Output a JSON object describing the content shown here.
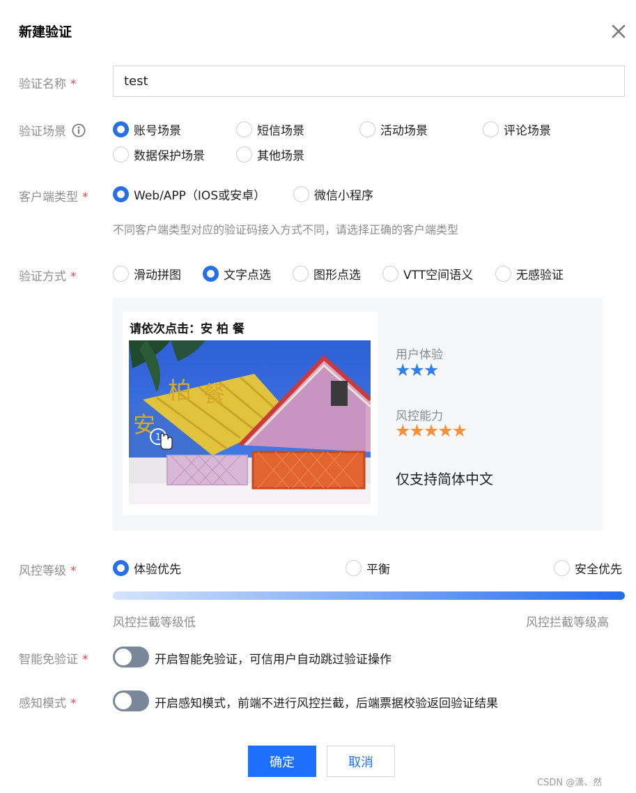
{
  "dialog": {
    "title": "新建验证"
  },
  "form": {
    "name": {
      "label": "验证名称",
      "value": "test"
    },
    "scene": {
      "label": "验证场景",
      "options": [
        "账号场景",
        "短信场景",
        "活动场景",
        "评论场景",
        "数据保护场景",
        "其他场景"
      ],
      "selected": "账号场景"
    },
    "client_type": {
      "label": "客户端类型",
      "options": [
        "Web/APP（IOS或安卓）",
        "微信小程序"
      ],
      "selected": "Web/APP（IOS或安卓）",
      "hint": "不同客户端类型对应的验证码接入方式不同，请选择正确的客户端类型"
    },
    "method": {
      "label": "验证方式",
      "options": [
        "滑动拼图",
        "文字点选",
        "图形点选",
        "VTT空间语义",
        "无感验证"
      ],
      "selected": "文字点选"
    },
    "preview": {
      "captcha_title": "请依次点击：安 柏 餐",
      "captcha_chars": [
        "安",
        "柏",
        "餐"
      ],
      "user_experience_label": "用户体验",
      "user_experience_stars": 3,
      "risk_control_label": "风控能力",
      "risk_control_stars": 5,
      "note": "仅支持简体中文"
    },
    "risk_level": {
      "label": "风控等级",
      "options": [
        "体验优先",
        "平衡",
        "安全优先"
      ],
      "selected": "体验优先",
      "low_label": "风控拦截等级低",
      "high_label": "风控拦截等级高"
    },
    "smart_skip": {
      "label": "智能免验证",
      "enabled": false,
      "description": "开启智能免验证，可信用户自动跳过验证操作"
    },
    "perception": {
      "label": "感知模式",
      "enabled": false,
      "description": "开启感知模式，前端不进行风控拦截，后端票据校验返回验证结果"
    },
    "required_mark": "*"
  },
  "actions": {
    "confirm": "确定",
    "cancel": "取消"
  },
  "watermark": "CSDN @潇、然",
  "colors": {
    "primary": "#1f6fff",
    "radio_checked": "#266fe8",
    "required": "#e54545",
    "star_blue": "#2f80ed",
    "star_orange": "#f98f3a",
    "toggle_off": "#7a8699"
  }
}
